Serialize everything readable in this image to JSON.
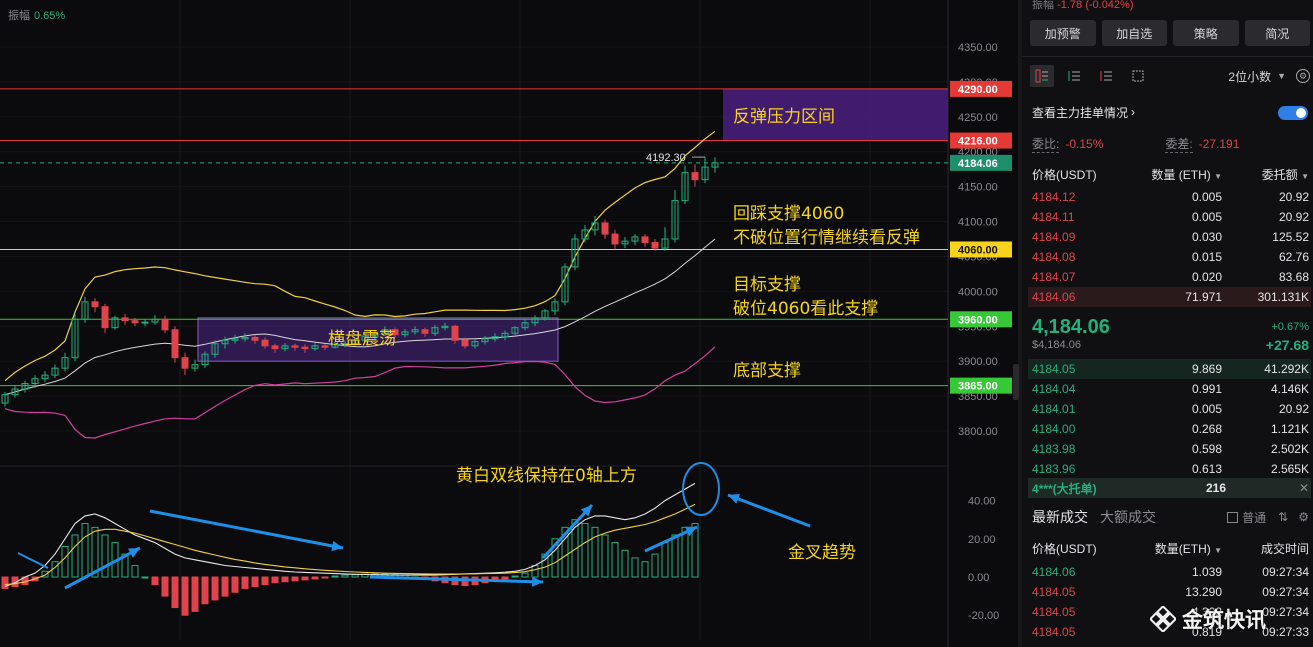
{
  "chart": {
    "amplitude_label": "振幅",
    "amplitude_value": "0.65%",
    "price_axis_labels": [
      {
        "text": "4350.00",
        "price": 4350
      },
      {
        "text": "4300.00",
        "price": 4300
      },
      {
        "text": "4250.00",
        "price": 4250
      },
      {
        "text": "4200.00",
        "price": 4200
      },
      {
        "text": "4150.00",
        "price": 4150
      },
      {
        "text": "4100.00",
        "price": 4100
      },
      {
        "text": "4050.00",
        "price": 4050
      },
      {
        "text": "4000.00",
        "price": 4000
      },
      {
        "text": "3950.00",
        "price": 3950
      },
      {
        "text": "3900.00",
        "price": 3900
      },
      {
        "text": "3850.00",
        "price": 3850
      },
      {
        "text": "3800.00",
        "price": 3800
      }
    ],
    "macd_axis_labels": [
      {
        "text": "40.00",
        "value": 40
      },
      {
        "text": "20.00",
        "value": 20
      },
      {
        "text": "0.00",
        "value": 0
      },
      {
        "text": "-20.00",
        "value": -20
      }
    ],
    "level_lines": [
      {
        "price": 4290,
        "label": "4290.00",
        "color": "#e53935"
      },
      {
        "price": 4216,
        "label": "4216.00",
        "color": "#e53935"
      },
      {
        "price": 4060,
        "label": "4060.00",
        "color": "#f7d41b"
      },
      {
        "price": 3960,
        "label": "3960.00",
        "color": "#37c837"
      },
      {
        "price": 3865,
        "label": "3865.00",
        "color": "#37c837"
      }
    ],
    "current_price_label": "4184.06",
    "current_price": 4184.06,
    "high_marker": "4192.30",
    "annotations": {
      "resistance_zone": "反弹压力区间",
      "pullback_support_1": "回踩支撑4060",
      "pullback_support_2": "不破位置行情继续看反弹",
      "target_support_1": "目标支撑",
      "target_support_2": "破位4060看此支撑",
      "bottom_support": "底部支撑",
      "sideways": "横盘震荡",
      "macd_note": "黄白双线保持在0轴上方",
      "golden_cross": "金叉趋势"
    },
    "colors": {
      "up": "#22b07d",
      "down": "#e0434b",
      "mid_band": "#f0d040",
      "upper_lower_band": "#d040a0",
      "zone_fill": "#4b1f80",
      "annotation_text": "#f7d41b",
      "arrow": "#1e8ee6"
    }
  },
  "chart_data": {
    "type": "candlestick",
    "series": [
      {
        "name": "candles",
        "values": [
          [
            3840,
            3852,
            3835,
            3856
          ],
          [
            3852,
            3860,
            3848,
            3866
          ],
          [
            3860,
            3868,
            3855,
            3872
          ],
          [
            3868,
            3875,
            3862,
            3880
          ],
          [
            3875,
            3880,
            3870,
            3886
          ],
          [
            3880,
            3890,
            3876,
            3895
          ],
          [
            3890,
            3905,
            3885,
            3912
          ],
          [
            3905,
            3960,
            3900,
            3968
          ],
          [
            3960,
            3985,
            3955,
            3992
          ],
          [
            3985,
            3978,
            3970,
            3990
          ],
          [
            3978,
            3948,
            3940,
            3982
          ],
          [
            3948,
            3962,
            3945,
            3965
          ],
          [
            3962,
            3958,
            3952,
            3968
          ],
          [
            3958,
            3955,
            3950,
            3962
          ],
          [
            3955,
            3956,
            3950,
            3960
          ],
          [
            3956,
            3960,
            3952,
            3966
          ],
          [
            3960,
            3945,
            3940,
            3965
          ],
          [
            3945,
            3905,
            3898,
            3950
          ],
          [
            3905,
            3890,
            3880,
            3912
          ],
          [
            3890,
            3895,
            3885,
            3902
          ],
          [
            3895,
            3910,
            3890,
            3914
          ],
          [
            3910,
            3925,
            3905,
            3930
          ],
          [
            3925,
            3930,
            3918,
            3935
          ],
          [
            3930,
            3932,
            3925,
            3938
          ],
          [
            3932,
            3934,
            3928,
            3940
          ],
          [
            3934,
            3930,
            3925,
            3938
          ],
          [
            3930,
            3922,
            3918,
            3934
          ],
          [
            3922,
            3918,
            3912,
            3925
          ],
          [
            3918,
            3922,
            3914,
            3926
          ],
          [
            3922,
            3920,
            3915,
            3925
          ],
          [
            3920,
            3918,
            3912,
            3924
          ],
          [
            3918,
            3922,
            3915,
            3926
          ],
          [
            3922,
            3920,
            3916,
            3925
          ],
          [
            3920,
            3924,
            3918,
            3928
          ],
          [
            3924,
            3925,
            3920,
            3930
          ],
          [
            3925,
            3930,
            3922,
            3934
          ],
          [
            3930,
            3936,
            3926,
            3940
          ],
          [
            3936,
            3940,
            3932,
            3944
          ],
          [
            3940,
            3945,
            3936,
            3950
          ],
          [
            3945,
            3938,
            3934,
            3948
          ],
          [
            3938,
            3942,
            3934,
            3946
          ],
          [
            3942,
            3945,
            3938,
            3950
          ],
          [
            3945,
            3940,
            3935,
            3948
          ],
          [
            3940,
            3948,
            3936,
            3952
          ],
          [
            3948,
            3950,
            3944,
            3955
          ],
          [
            3950,
            3930,
            3925,
            3952
          ],
          [
            3930,
            3922,
            3918,
            3934
          ],
          [
            3922,
            3928,
            3918,
            3932
          ],
          [
            3928,
            3932,
            3924,
            3936
          ],
          [
            3932,
            3935,
            3928,
            3940
          ],
          [
            3935,
            3940,
            3930,
            3944
          ],
          [
            3940,
            3948,
            3936,
            3950
          ],
          [
            3948,
            3955,
            3944,
            3960
          ],
          [
            3955,
            3962,
            3950,
            3966
          ],
          [
            3962,
            3972,
            3958,
            3975
          ],
          [
            3972,
            3985,
            3966,
            3990
          ],
          [
            3985,
            4035,
            3980,
            4040
          ],
          [
            4035,
            4075,
            4030,
            4082
          ],
          [
            4075,
            4088,
            4070,
            4095
          ],
          [
            4088,
            4098,
            4080,
            4108
          ],
          [
            4098,
            4082,
            4075,
            4103
          ],
          [
            4082,
            4068,
            4060,
            4088
          ],
          [
            4068,
            4072,
            4062,
            4078
          ],
          [
            4072,
            4078,
            4066,
            4082
          ],
          [
            4078,
            4070,
            4064,
            4082
          ],
          [
            4070,
            4062,
            4058,
            4075
          ],
          [
            4062,
            4075,
            4058,
            4092
          ],
          [
            4075,
            4130,
            4070,
            4145
          ],
          [
            4130,
            4170,
            4125,
            4180
          ],
          [
            4170,
            4160,
            4150,
            4182
          ],
          [
            4160,
            4178,
            4155,
            4192.3
          ],
          [
            4178,
            4184.06,
            4170,
            4192
          ]
        ]
      }
    ],
    "macd": {
      "dif": [
        -5,
        -3,
        0,
        2,
        6,
        12,
        20,
        28,
        32,
        33,
        31,
        28,
        25,
        22,
        20,
        18,
        15,
        12,
        10,
        9,
        8,
        7,
        6,
        5.5,
        5,
        4.5,
        4,
        3.5,
        3,
        2.6,
        2.4,
        2.2,
        2,
        1.8,
        1.6,
        1.4,
        1.3,
        1.2,
        1.1,
        1,
        1,
        1,
        1,
        1,
        1.2,
        1.4,
        1.6,
        1.8,
        2,
        2.2,
        2.5,
        3,
        4,
        6,
        9,
        14,
        20,
        26,
        30,
        32,
        32,
        31,
        30,
        31,
        33,
        36,
        40,
        43,
        46,
        49
      ],
      "dea": [
        -4,
        -3.5,
        -2.5,
        -1,
        1,
        5,
        10,
        16,
        21,
        24,
        25,
        25,
        24,
        23,
        21.5,
        20,
        18.5,
        17,
        15.5,
        14,
        12.7,
        11.5,
        10.3,
        9.2,
        8.3,
        7.4,
        6.6,
        5.9,
        5.3,
        4.8,
        4.3,
        3.9,
        3.5,
        3.2,
        2.9,
        2.6,
        2.4,
        2.2,
        2,
        1.9,
        1.8,
        1.7,
        1.6,
        1.5,
        1.5,
        1.5,
        1.6,
        1.7,
        1.8,
        1.9,
        2,
        2.3,
        2.8,
        3.8,
        5.2,
        7.5,
        11,
        14.5,
        18,
        21,
        23,
        24.5,
        25.5,
        26.5,
        27.5,
        29,
        31,
        33,
        35.5,
        38
      ],
      "hist": [
        -6,
        -5,
        -4,
        -2,
        3,
        8,
        16,
        22,
        28,
        26,
        22,
        18,
        12,
        6,
        0,
        -4,
        -10,
        -16,
        -20,
        -18,
        -14,
        -12,
        -10,
        -8,
        -6,
        -5,
        -4,
        -3,
        -2.5,
        -2,
        -1.5,
        -1,
        -0.5,
        0.5,
        1,
        1.2,
        1.5,
        1.6,
        1.5,
        1.2,
        1,
        0,
        -1,
        -2,
        -3,
        -4,
        -4.5,
        -4,
        -3,
        -2,
        -1,
        0.5,
        2,
        6,
        12,
        20,
        26,
        30,
        28,
        26,
        22,
        18,
        14,
        10,
        8,
        12,
        18,
        22,
        26,
        28
      ]
    },
    "price_ylim": [
      3780,
      4370
    ],
    "macd_ylim": [
      -25,
      48
    ],
    "levels": [
      4290,
      4216,
      4060,
      3960,
      3865
    ]
  },
  "panel": {
    "top_line_label": "振幅",
    "top_line_value": "-1.78 (-0.042%)",
    "buttons": [
      "加预警",
      "加自选",
      "策略",
      "简况"
    ],
    "decimal_select": "2位小数",
    "main_orders_link": "查看主力挂单情况",
    "commission_ratio_label": "委比:",
    "commission_ratio_value": "-0.15%",
    "commission_diff_label": "委差:",
    "commission_diff_value": "-27.191",
    "book_headers": [
      "价格(USDT)",
      "数量 (ETH)",
      "委托额"
    ],
    "asks": [
      {
        "price": "4184.12",
        "qty": "0.005",
        "amount": "20.92"
      },
      {
        "price": "4184.11",
        "qty": "0.005",
        "amount": "20.92"
      },
      {
        "price": "4184.09",
        "qty": "0.030",
        "amount": "125.52"
      },
      {
        "price": "4184.08",
        "qty": "0.015",
        "amount": "62.76"
      },
      {
        "price": "4184.07",
        "qty": "0.020",
        "amount": "83.68"
      },
      {
        "price": "4184.06",
        "qty": "71.971",
        "amount": "301.131K"
      }
    ],
    "last_price": "4,184.06",
    "last_price_sub": "$4,184.06",
    "change_pct": "+0.67%",
    "change_abs": "+27.68",
    "bids": [
      {
        "price": "4184.05",
        "qty": "9.869",
        "amount": "41.292K"
      },
      {
        "price": "4184.04",
        "qty": "0.991",
        "amount": "4.146K"
      },
      {
        "price": "4184.01",
        "qty": "0.005",
        "amount": "20.92"
      },
      {
        "price": "4184.00",
        "qty": "0.268",
        "amount": "1.121K"
      },
      {
        "price": "4183.98",
        "qty": "0.598",
        "amount": "2.502K"
      },
      {
        "price": "4183.96",
        "qty": "0.613",
        "amount": "2.565K"
      }
    ],
    "big_order_label": "4***(大托单)",
    "big_order_value": "216",
    "trade_tabs": [
      "最新成交",
      "大额成交"
    ],
    "normal_label": "普通",
    "trade_headers": [
      "价格(USDT)",
      "数量(ETH)",
      "成交时间"
    ],
    "trades": [
      {
        "price": "4184.06",
        "qty": "1.039",
        "time": "09:27:34",
        "side": "buy"
      },
      {
        "price": "4184.05",
        "qty": "13.290",
        "time": "09:27:34",
        "side": "sell"
      },
      {
        "price": "4184.05",
        "qty": "4.302",
        "time": "09:27:34",
        "side": "sell"
      },
      {
        "price": "4184.05",
        "qty": "0.819",
        "time": "09:27:33",
        "side": "sell"
      }
    ]
  },
  "watermark": "金筑快讯"
}
